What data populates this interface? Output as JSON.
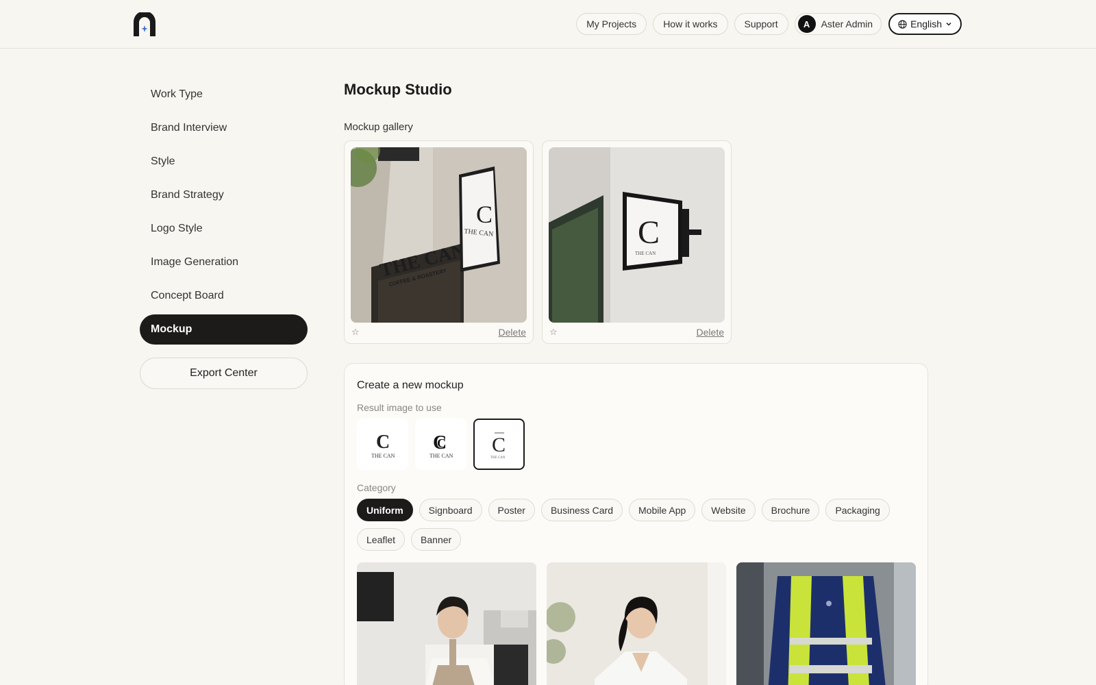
{
  "header": {
    "nav": [
      "My Projects",
      "How it works",
      "Support"
    ],
    "user": {
      "initial": "A",
      "name": "Aster Admin"
    },
    "language": "English"
  },
  "sidebar": {
    "items": [
      "Work Type",
      "Brand Interview",
      "Style",
      "Brand Strategy",
      "Logo Style",
      "Image Generation",
      "Concept Board",
      "Mockup"
    ],
    "active": "Mockup",
    "export_label": "Export Center"
  },
  "main": {
    "title": "Mockup Studio",
    "gallery_label": "Mockup gallery",
    "gallery": [
      {
        "sign_text": "THE CAN",
        "sub_text": "COFFEE & ROASTERY",
        "delete_label": "Delete",
        "star": "☆"
      },
      {
        "sign_text": "THE CAN",
        "delete_label": "Delete",
        "star": "☆"
      }
    ],
    "create": {
      "title": "Create a new mockup",
      "result_label": "Result image to use",
      "result_images": [
        {
          "text": "THE CAN",
          "selected": false
        },
        {
          "text": "THE CAN",
          "selected": false
        },
        {
          "text": "THE CAN",
          "selected": true
        }
      ],
      "category_label": "Category",
      "categories": [
        "Uniform",
        "Signboard",
        "Poster",
        "Business Card",
        "Mobile App",
        "Website",
        "Brochure",
        "Packaging",
        "Leaflet",
        "Banner"
      ],
      "active_category": "Uniform"
    }
  },
  "colors": {
    "background": "#f8f6f1",
    "active": "#1c1b1a",
    "border": "#dedad2"
  }
}
